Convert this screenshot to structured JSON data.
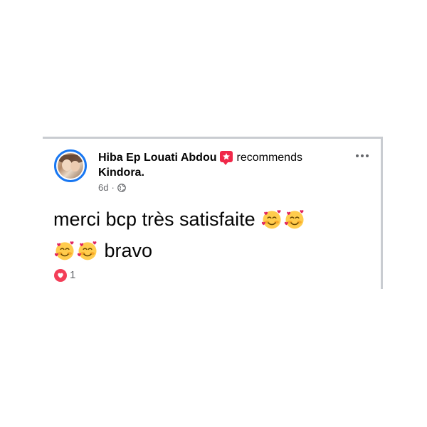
{
  "post": {
    "author": "Hiba Ep Louati Abdou",
    "verb": "recommends",
    "page": "Kindora.",
    "time": "6d",
    "separator": "·",
    "text_part1": "merci bcp très satisfaite",
    "text_part2": "bravo",
    "reaction_count": "1"
  },
  "icons": {
    "avatar": "profile-photo",
    "recommend": "recommend-star-icon",
    "audience": "globe-icon",
    "more": "more-options-icon",
    "emoji": "smiling-face-with-hearts-emoji",
    "reaction": "love-reaction-icon"
  },
  "colors": {
    "story_ring": "#1877f2",
    "recommend_badge": "#f02849",
    "love_reaction": "#f33e58",
    "secondary_text": "#65676b",
    "primary_text": "#050505"
  }
}
